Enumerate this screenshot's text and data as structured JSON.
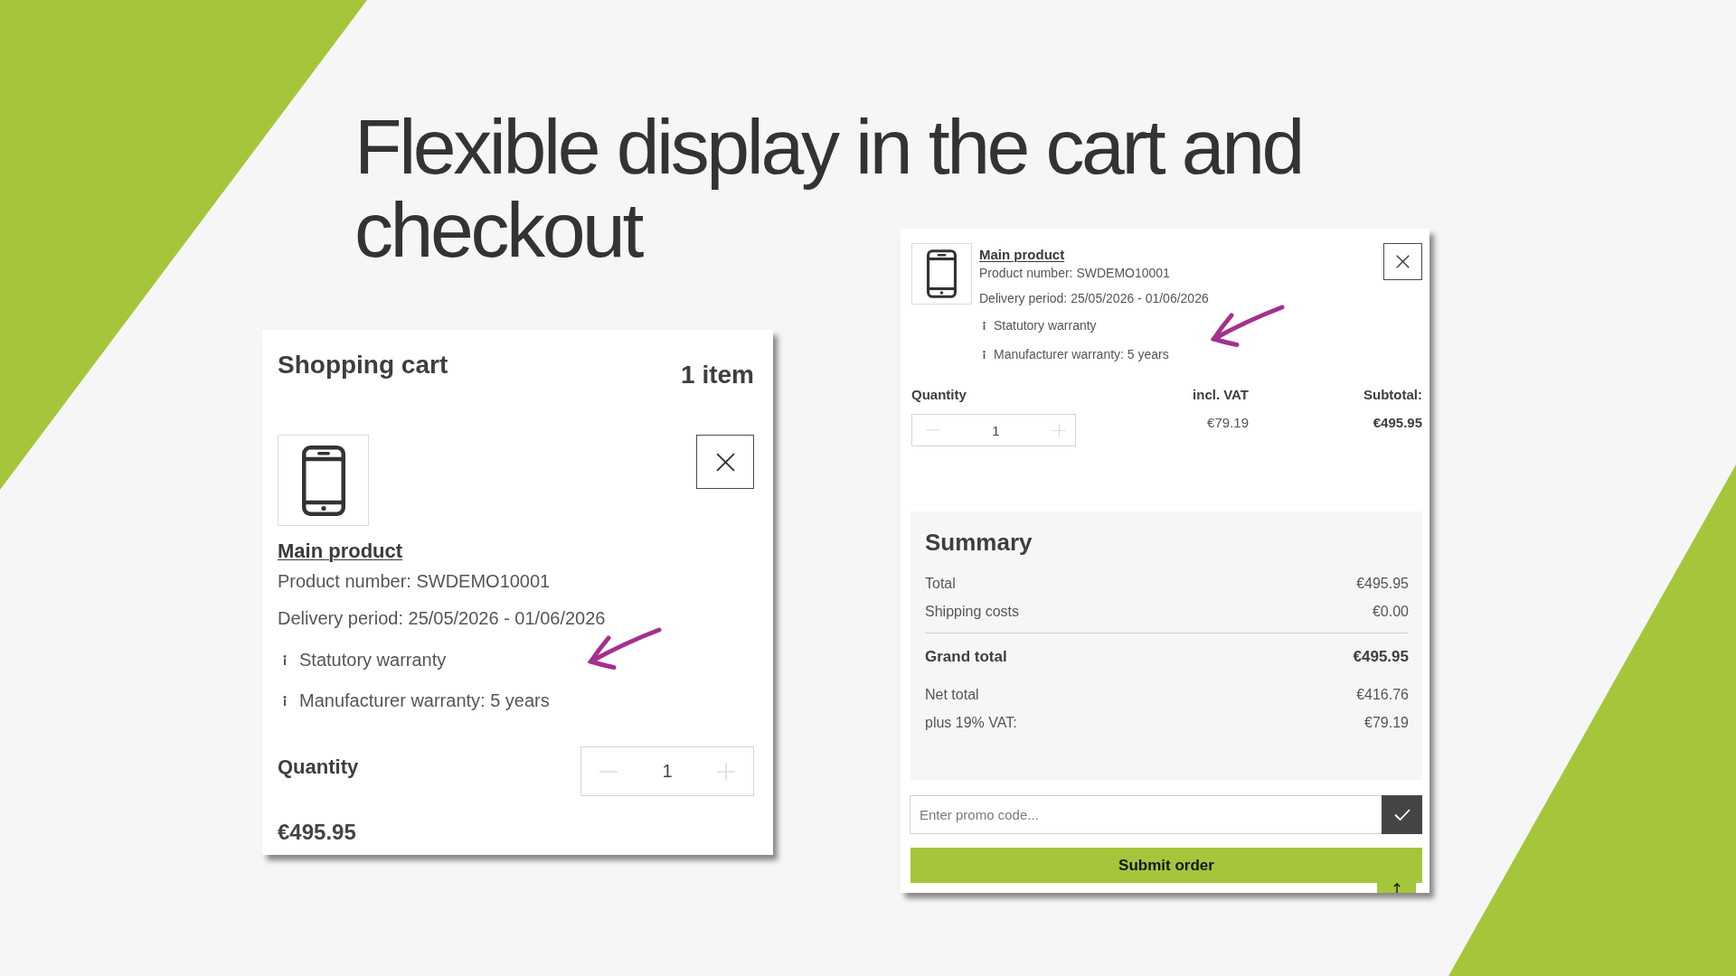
{
  "title_lines": [
    "Flexible display in the cart and",
    "checkout"
  ],
  "cart": {
    "title": "Shopping cart",
    "item_count": "1 item",
    "product": {
      "name": "Main product",
      "product_number": "Product number: SWDEMO10001",
      "delivery_period": "Delivery period: 25/05/2026 - 01/06/2026",
      "notes": [
        "Statutory warranty",
        "Manufacturer warranty: 5 years"
      ]
    },
    "quantity_label": "Quantity",
    "quantity": "1",
    "price": "€495.95"
  },
  "checkout": {
    "product": {
      "name": "Main product",
      "product_number": "Product number: SWDEMO10001",
      "delivery_period": "Delivery period: 25/05/2026 - 01/06/2026",
      "notes": [
        "Statutory warranty",
        "Manufacturer warranty: 5 years"
      ]
    },
    "columns": [
      "Quantity",
      "incl. VAT",
      "Subtotal:"
    ],
    "quantity": "1",
    "vat": "€79.19",
    "subtotal": "€495.95",
    "summary": {
      "title": "Summary",
      "rows": [
        {
          "kind": "line",
          "label": "Total",
          "value": "€495.95"
        },
        {
          "kind": "line",
          "label": "Shipping costs",
          "value": "€0.00"
        },
        {
          "kind": "grand_total",
          "label": "Grand total",
          "value": "€495.95"
        },
        {
          "kind": "line",
          "label": "Net total",
          "value": "€416.76"
        },
        {
          "kind": "line",
          "label": "plus 19% VAT:",
          "value": "€79.19"
        }
      ]
    },
    "promo": {
      "placeholder": "Enter promo code..."
    },
    "submit_label": "Submit order"
  }
}
